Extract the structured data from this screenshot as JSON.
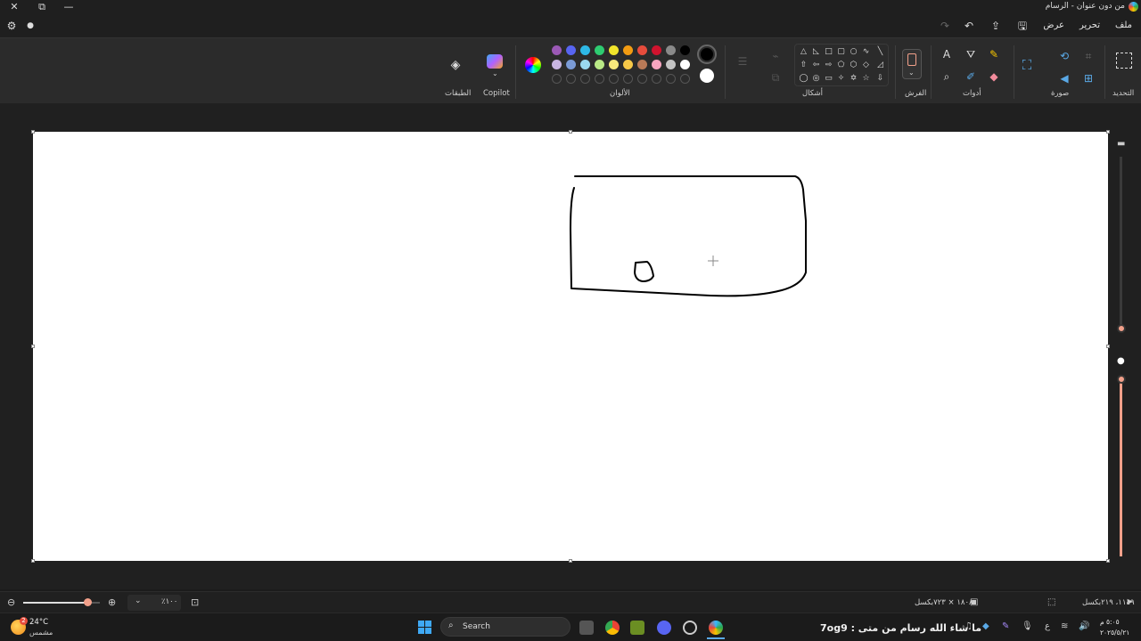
{
  "window": {
    "title": "من دون عنوان - الرسام",
    "controls": {
      "close": "✕",
      "restore": "⧉",
      "minimize": "—"
    }
  },
  "menu": {
    "file": "ملف",
    "edit": "تحرير",
    "view": "عرض"
  },
  "ribbon": {
    "groups": {
      "selection": "التحديد",
      "image": "صورة",
      "tools": "أدوات",
      "brushes": "الفرش",
      "shapes": "أشكال",
      "colors": "الألوان",
      "copilot": "Copilot",
      "layers": "الطبقات"
    },
    "palette_row1": [
      "#9b59b6",
      "#5865f2",
      "#2eb8e6",
      "#2ecc71",
      "#f1e52b",
      "#f39c12",
      "#e74c3c",
      "#d0132e",
      "#8a8a8a",
      "#000000"
    ],
    "palette_row2": [
      "#c8b6e2",
      "#7b9bd6",
      "#9ad9ee",
      "#b9e986",
      "#f8e97c",
      "#f7c948",
      "#b97a57",
      "#f9a6c0",
      "#c3c3c3",
      "#ffffff"
    ],
    "primary_color": "#000000",
    "secondary_color": "#ffffff"
  },
  "status": {
    "cursor_pos": "١١٤٩، ٢١٩بكسل",
    "canvas_size": "١٨٠٨ × ٧٢٣بكسل",
    "zoom": "٪١٠٠"
  },
  "taskbar": {
    "weather_temp": "24°C",
    "weather_desc": "مشمس",
    "weather_badge": "2",
    "search": "Search",
    "banner": "ما شاء الله رسام من متى : 7og9",
    "time": "٥:٠٥ م",
    "date": "٢٠٢٥/٥/٢١"
  },
  "colors": {
    "accent": "#f2a08a",
    "canvas": "#ffffff",
    "workspace": "#202020"
  }
}
